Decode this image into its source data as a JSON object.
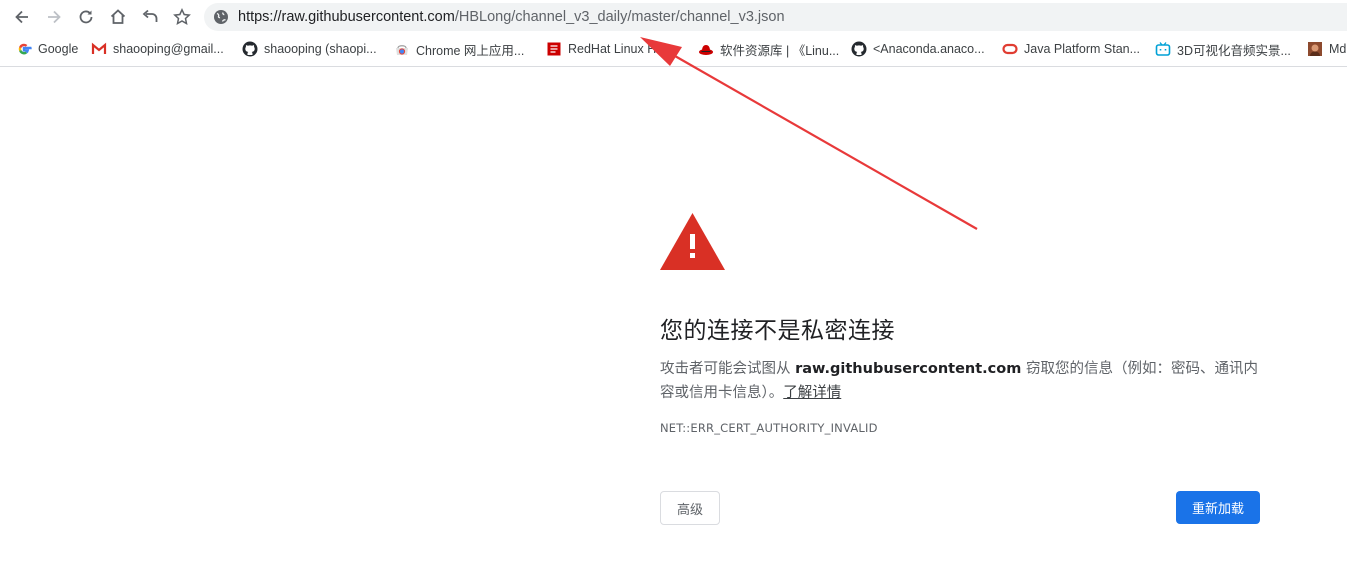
{
  "toolbar": {
    "url_host": "https://raw.githubusercontent.com",
    "url_path": "/HBLong/channel_v3_daily/master/channel_v3.json"
  },
  "bookmarks": [
    {
      "label": "Google",
      "icon": "google-icon"
    },
    {
      "label": "shaooping@gmail...",
      "icon": "gmail-icon"
    },
    {
      "label": "shaooping (shaopi...",
      "icon": "github-icon"
    },
    {
      "label": "Chrome 网上应用...",
      "icon": "chrome-web-store-icon"
    },
    {
      "label": "RedHat Linux Hel...",
      "icon": "redhat-book-icon"
    },
    {
      "label": "软件资源库 | 《Linu...",
      "icon": "redhat-icon"
    },
    {
      "label": "<Anaconda.anaco...",
      "icon": "github-icon"
    },
    {
      "label": "Java Platform Stan...",
      "icon": "oracle-icon"
    },
    {
      "label": "3D可视化音频实景...",
      "icon": "bilibili-icon"
    },
    {
      "label": "Md",
      "icon": "md-icon"
    }
  ],
  "interstitial": {
    "heading": "您的连接不是私密连接",
    "explanation_prefix": "攻击者可能会试图从 ",
    "explanation_host": "raw.githubusercontent.com",
    "explanation_suffix": " 窃取您的信息（例如：密码、通讯内容或信用卡信息）。",
    "learn_more": "了解详情",
    "error_code": "NET::ERR_CERT_AUTHORITY_INVALID",
    "advanced_label": "高级",
    "reload_label": "重新加载"
  },
  "colors": {
    "warning_red": "#d93025",
    "reload_blue": "#1a73e8",
    "annotation_red": "#e8393a"
  }
}
